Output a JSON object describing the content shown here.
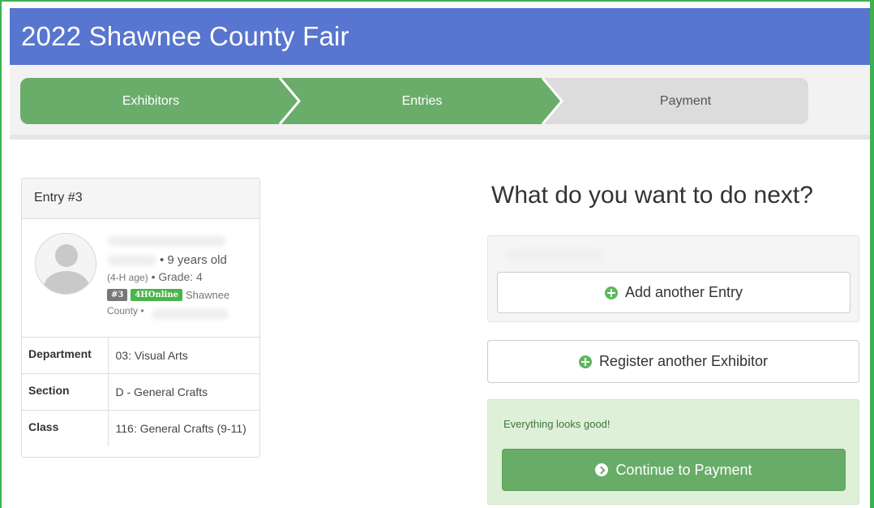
{
  "header": {
    "title": "2022 Shawnee County Fair"
  },
  "steps": [
    {
      "label": "Exhibitors",
      "state": "complete"
    },
    {
      "label": "Entries",
      "state": "complete"
    },
    {
      "label": "Payment",
      "state": "pending"
    }
  ],
  "entry": {
    "heading": "Entry #3",
    "age_text": "• 9 years old",
    "age_note": "(4-H age)",
    "grade_text": "• Grade: 4",
    "badge_number": "#3",
    "badge_source": "4HOnline",
    "county_part1": "Shawnee",
    "county_part2": "County •",
    "details": [
      {
        "key": "Department",
        "value": "03: Visual Arts"
      },
      {
        "key": "Section",
        "value": "D - General Crafts"
      },
      {
        "key": "Class",
        "value": "116: General Crafts (9-11)"
      }
    ]
  },
  "next": {
    "title": "What do you want to do next?",
    "add_entry_label": "Add another Entry",
    "register_label": "Register another Exhibitor",
    "status_text": "Everything looks good!",
    "continue_label": "Continue to Payment"
  },
  "colors": {
    "header": "#5875cf",
    "step_complete": "#6aad6a",
    "step_pending": "#dcdcdc",
    "success_panel": "#dff0d8",
    "button_green": "#68ac68"
  },
  "icons": {
    "add_entry": "plus-circle-icon",
    "register": "plus-circle-icon",
    "continue": "arrow-circle-right-icon",
    "avatar": "user-placeholder-icon"
  }
}
